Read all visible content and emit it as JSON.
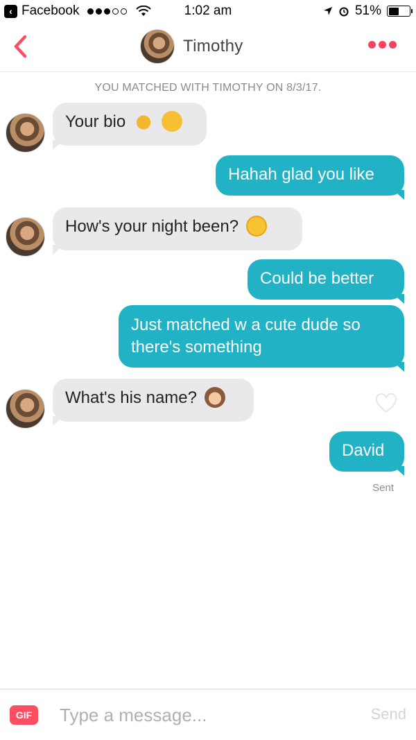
{
  "status_bar": {
    "carrier_app": "Facebook",
    "time": "1:02 am",
    "battery_text": "51%",
    "battery_level": 0.51
  },
  "header": {
    "name": "Timothy"
  },
  "chat": {
    "match_note": "YOU MATCHED WITH TIMOTHY ON 8/3/17.",
    "messages": [
      {
        "from": "them",
        "text": "Your bio"
      },
      {
        "from": "me",
        "text": "Hahah glad you like"
      },
      {
        "from": "them",
        "text": "How's your night been?"
      },
      {
        "from": "me",
        "text": "Could be better"
      },
      {
        "from": "me",
        "line1": "Just matched w a cute dude so",
        "line2": "there's something"
      },
      {
        "from": "them",
        "text": "What's his name?"
      },
      {
        "from": "me",
        "text": "David"
      }
    ],
    "sent_label": "Sent"
  },
  "composer": {
    "gif_label": "GIF",
    "placeholder": "Type a message...",
    "send_label": "Send"
  },
  "colors": {
    "accent": "#fd4d61",
    "outgoing_bubble": "#22b2c6",
    "incoming_bubble": "#e9e9eb"
  }
}
